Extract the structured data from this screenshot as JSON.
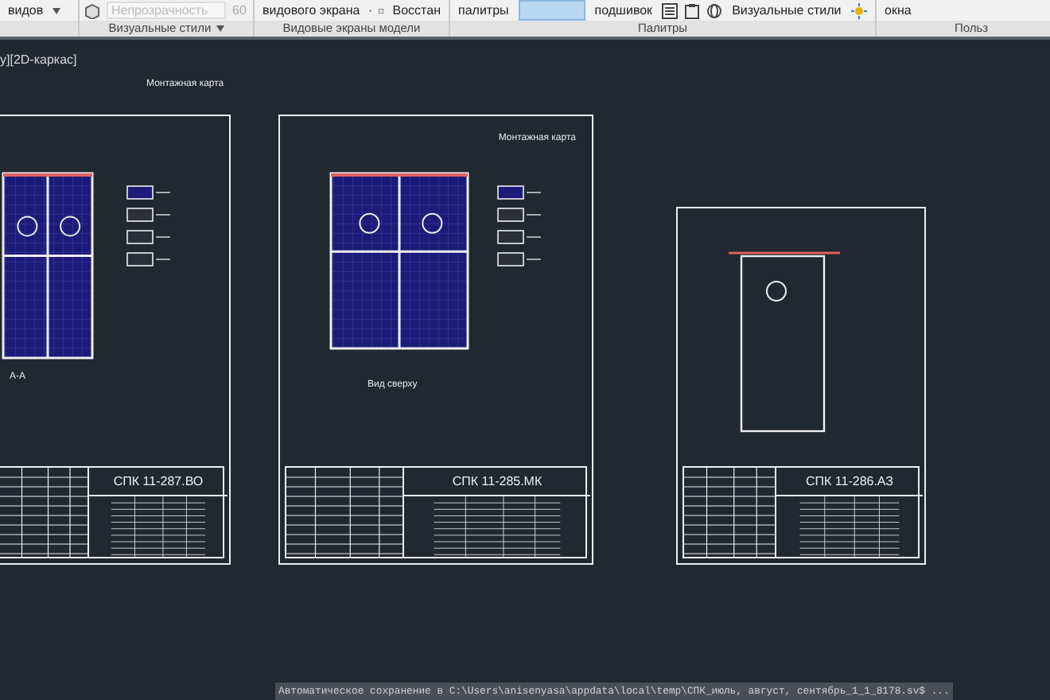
{
  "ribbon": {
    "panels": [
      {
        "tools": [
          {
            "kind": "dropdown",
            "label": "видов"
          }
        ]
      },
      {
        "label": "Визуальные стили",
        "tools": [
          {
            "kind": "field",
            "value": "Непрозрачность",
            "disabled": true
          },
          {
            "kind": "text",
            "label": "60"
          }
        ]
      },
      {
        "label": "Видовые экраны модели",
        "tools": [
          {
            "kind": "dropdown",
            "label": "видового экрана"
          },
          {
            "kind": "icon-button",
            "label": "Восстан"
          }
        ]
      },
      {
        "label": "Палитры",
        "tools": [
          {
            "kind": "button",
            "label": "палитры",
            "selected": false
          },
          {
            "kind": "button",
            "selected": true
          },
          {
            "kind": "button",
            "label": "подшивок",
            "selected": false
          },
          {
            "kind": "icon"
          },
          {
            "kind": "icon"
          },
          {
            "kind": "icon-button",
            "label": "Визуальные стили"
          },
          {
            "kind": "icon"
          }
        ]
      },
      {
        "label": "Польз",
        "tools": [
          {
            "kind": "button",
            "label": "окна",
            "selected": false
          }
        ]
      }
    ]
  },
  "viewport_label": "у][2D-каркас]",
  "canvas_labels": [
    {
      "text": "Монтажная карта"
    }
  ],
  "sheets": [
    {
      "kind": "wall-panel",
      "section_label": "А-А",
      "code": "СПК 11-287.ВО"
    },
    {
      "kind": "wall-panel",
      "heading": "Монтажная карта",
      "view_label": "Вид сверху",
      "code": "СПК 11-285.МК"
    },
    {
      "kind": "detail",
      "code": "СПК 11-286.АЗ"
    }
  ],
  "status_bar": {
    "message": "Автоматическое сохранение в C:\\Users\\anisenyasa\\appdata\\local\\temp\\СПК_июль, август, сентябрь_1_1_8178.sv$ ..."
  }
}
